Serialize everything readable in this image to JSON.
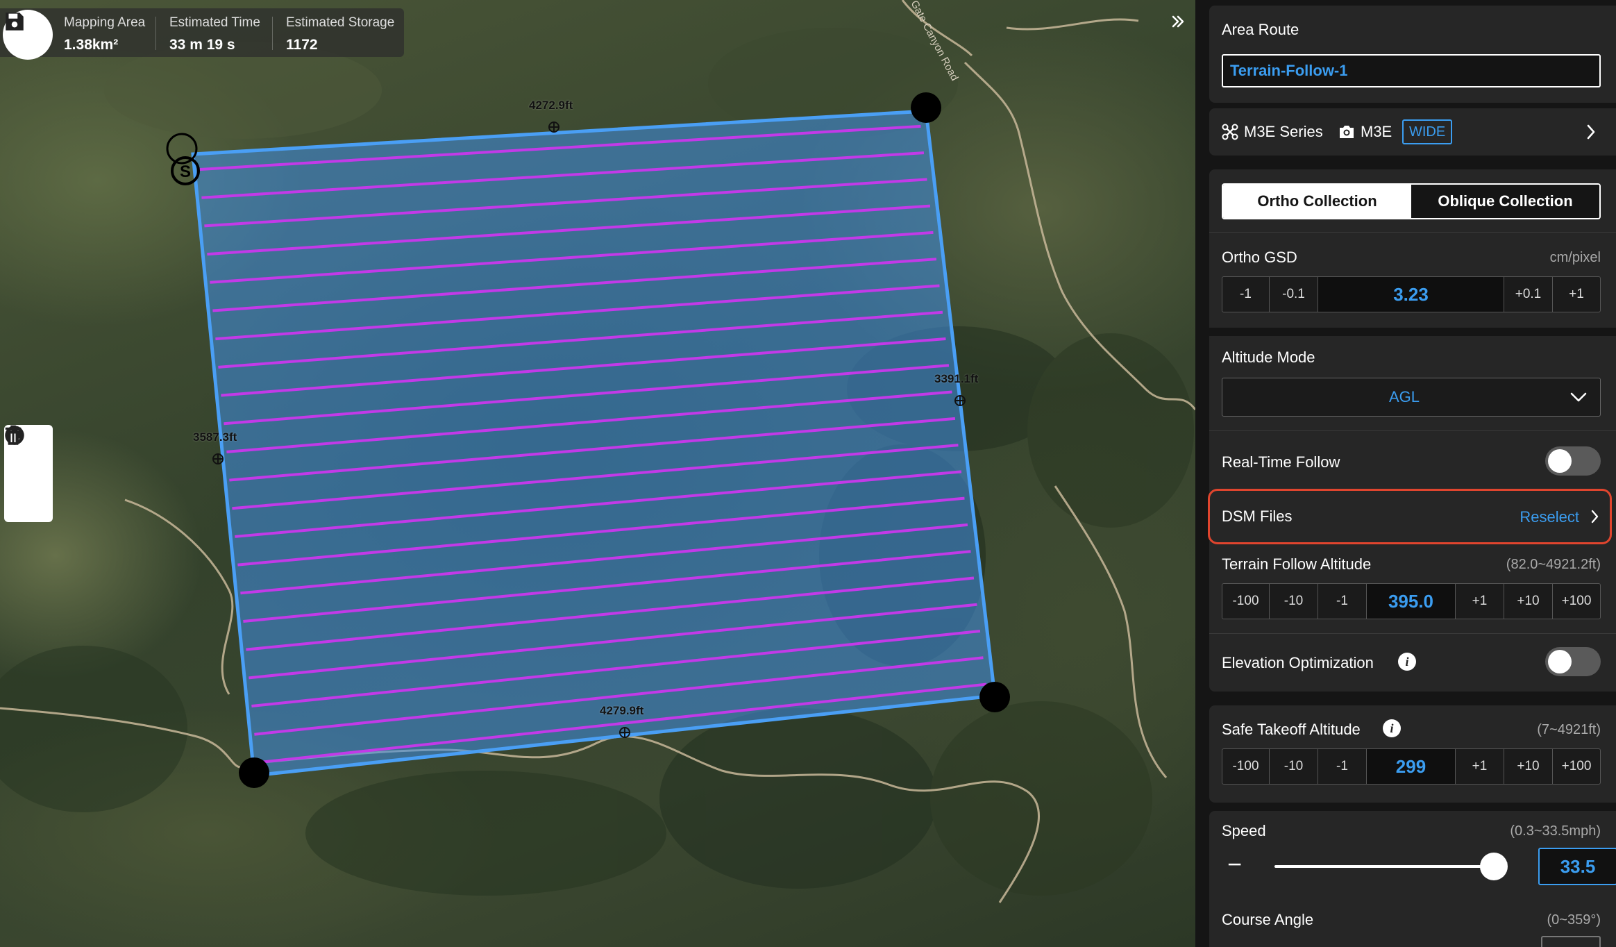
{
  "stats": {
    "mapping_area_label": "Mapping Area",
    "mapping_area_value": "1.38km²",
    "est_time_label": "Estimated Time",
    "est_time_value": "33 m 19 s",
    "est_storage_label": "Estimated Storage",
    "est_storage_value": "1172"
  },
  "map": {
    "elevations": [
      "4272.9ft",
      "3391.1ft",
      "3587.3ft",
      "4279.9ft"
    ],
    "start_marker": "S",
    "road_label": "Gate Canyon Road"
  },
  "icons": {
    "save": "save-icon",
    "close": "close-circle-icon",
    "delete": "trash-icon",
    "collapse": "double-chevron-right-icon",
    "drone": "drone-icon",
    "camera": "camera-icon",
    "chevron_right": "chevron-right-icon",
    "chevron_down": "chevron-down-icon"
  },
  "colors": {
    "accent": "#3b9df0",
    "area_fill": "#3f8fe6",
    "area_border": "#4a9ff5",
    "flight_lines": "#c23ae8",
    "highlight": "#e0452e"
  },
  "panel": {
    "area_route_label": "Area Route",
    "route_name": "Terrain-Follow-1",
    "drone_series": "M3E Series",
    "camera_model": "M3E",
    "lens_badge": "WIDE",
    "tab_ortho": "Ortho Collection",
    "tab_oblique": "Oblique Collection",
    "ortho_gsd_label": "Ortho GSD",
    "ortho_gsd_unit": "cm/pixel",
    "gsd_stepper": {
      "m1": "-1",
      "m01": "-0.1",
      "value": "3.23",
      "p01": "+0.1",
      "p1": "+1"
    },
    "altitude_mode_label": "Altitude Mode",
    "altitude_mode_value": "AGL",
    "real_time_follow_label": "Real-Time Follow",
    "real_time_follow_on": false,
    "dsm_files_label": "DSM Files",
    "dsm_reselect": "Reselect",
    "terrain_alt_label": "Terrain Follow Altitude",
    "terrain_alt_range": "(82.0~4921.2ft)",
    "terrain_stepper": {
      "m100": "-100",
      "m10": "-10",
      "m1": "-1",
      "value": "395.0",
      "p1": "+1",
      "p10": "+10",
      "p100": "+100"
    },
    "elev_opt_label": "Elevation Optimization",
    "elev_opt_on": false,
    "safe_takeoff_label": "Safe Takeoff Altitude",
    "safe_takeoff_range": "(7~4921ft)",
    "takeoff_stepper": {
      "m100": "-100",
      "m10": "-10",
      "m1": "-1",
      "value": "299",
      "p1": "+1",
      "p10": "+10",
      "p100": "+100"
    },
    "speed_label": "Speed",
    "speed_range": "(0.3~33.5mph)",
    "speed_value": "33.5",
    "speed_minus": "−",
    "speed_plus": "+",
    "course_angle_label": "Course Angle",
    "course_angle_range": "(0~359°)",
    "info_glyph": "i"
  }
}
